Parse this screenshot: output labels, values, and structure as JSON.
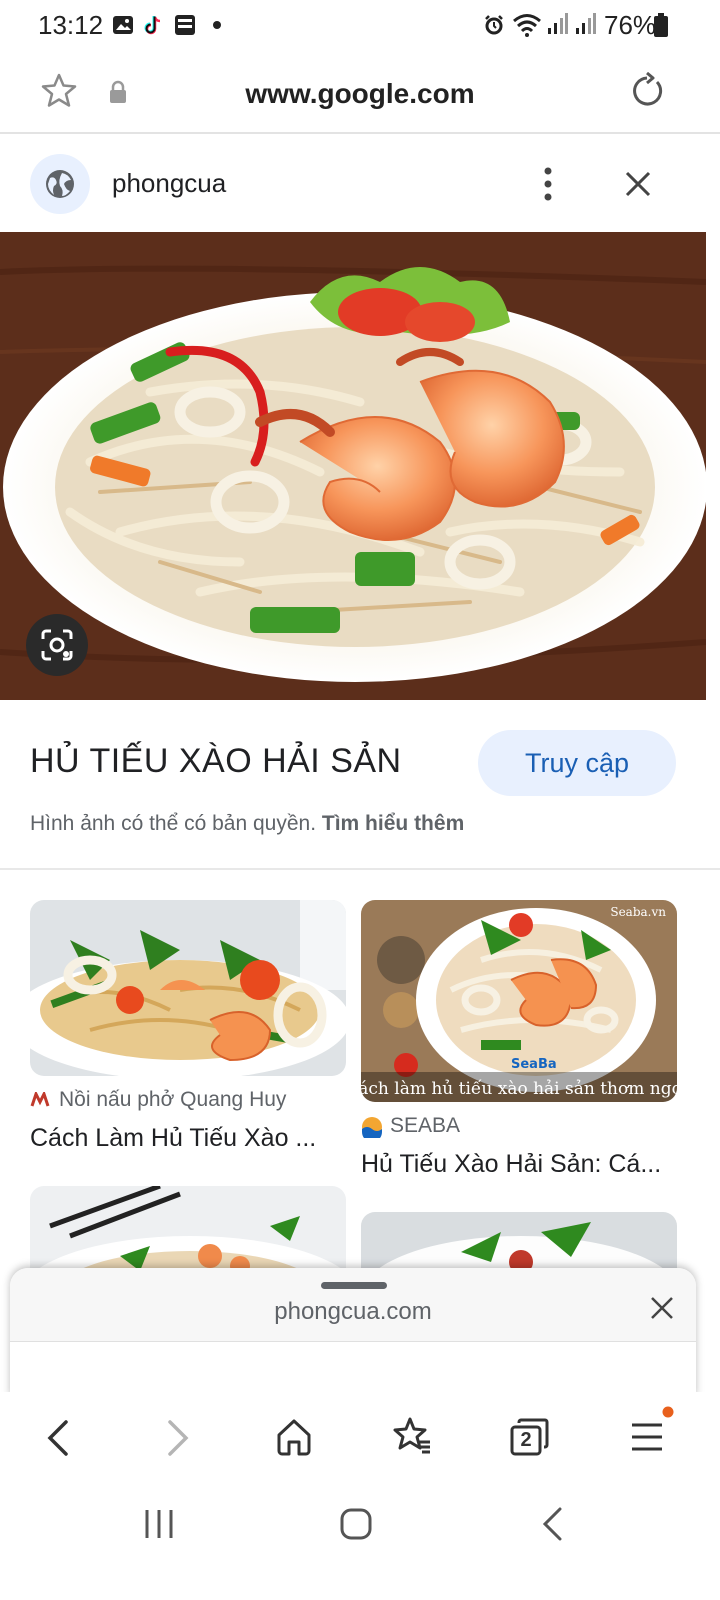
{
  "status_bar": {
    "time": "13:12",
    "battery_percent": "76%"
  },
  "url_bar": {
    "url": "www.google.com"
  },
  "site_header": {
    "name": "phongcua"
  },
  "result": {
    "title": "HỦ TIẾU XÀO HẢI SẢN",
    "visit_label": "Truy cập",
    "copyright_text": "Hình ảnh có thể có bản quyền.",
    "learn_more_label": "Tìm hiểu thêm"
  },
  "related": [
    {
      "source": "Nồi nấu phở Quang Huy",
      "caption": "Cách Làm Hủ Tiếu Xào ..."
    },
    {
      "source": "SEABA",
      "caption": "Hủ Tiếu Xào Hải Sản: Cá...",
      "overlay_text": "Cách làm hủ tiếu xào hải sản thơm ngon",
      "watermark": "Seaba.vn",
      "logo_text": "SeaBa"
    }
  ],
  "sheet": {
    "url": "phongcua.com"
  },
  "bottom_nav": {
    "tab_count": "2"
  },
  "colors": {
    "accent": "#1a5fb4",
    "visit_bg": "#e8f0fe",
    "notify_dot": "#e8601c"
  }
}
